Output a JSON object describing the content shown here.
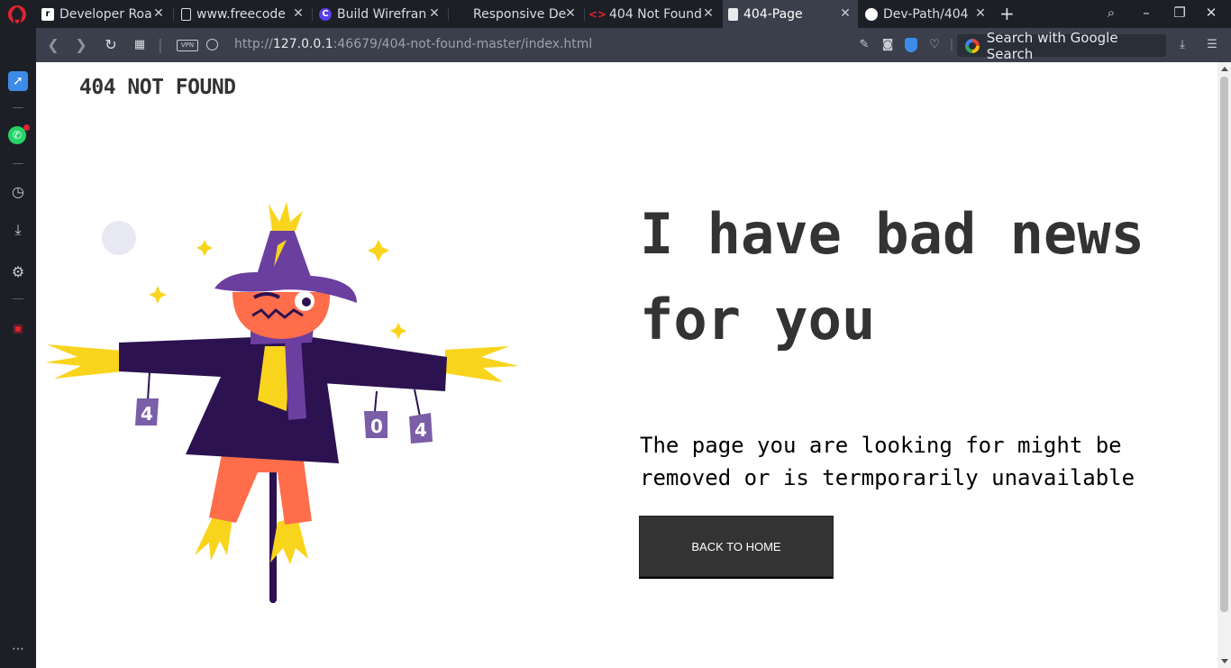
{
  "tabs": [
    {
      "label": "Developer Roa",
      "favicon": "roadmap-icon"
    },
    {
      "label": "www.freecode",
      "favicon": "page-icon"
    },
    {
      "label": "Build Wirefran",
      "favicon": "c-icon"
    },
    {
      "label": "Responsive De",
      "favicon": "dark-icon"
    },
    {
      "label": "404 Not Found",
      "favicon": "code-icon"
    },
    {
      "label": "404-Page",
      "favicon": "page-icon"
    },
    {
      "label": "Dev-Path/404",
      "favicon": "github-icon"
    }
  ],
  "address": {
    "vpn_label": "VPN",
    "url_prefix": "http://",
    "url_host": "127.0.0.1",
    "url_rest": ":46679/404-not-found-master/index.html",
    "search_placeholder": "Search with Google Search"
  },
  "page": {
    "brand": "404 NOT FOUND",
    "headline": "I have bad news for you",
    "subtext": "The page you are looking for might be removed or is termporarily unavailable",
    "button_label": "BACK TO HOME",
    "can_left": "4",
    "can_mid": "0",
    "can_right": "4"
  },
  "colors": {
    "accent": "#3d8be8",
    "opera_red": "#e0232f",
    "text_dark": "#333333",
    "scarecrow_purple": "#2c1250",
    "hat_purple": "#6b3fa0",
    "pumpkin": "#ff6d4a",
    "straw": "#f9d41c"
  }
}
